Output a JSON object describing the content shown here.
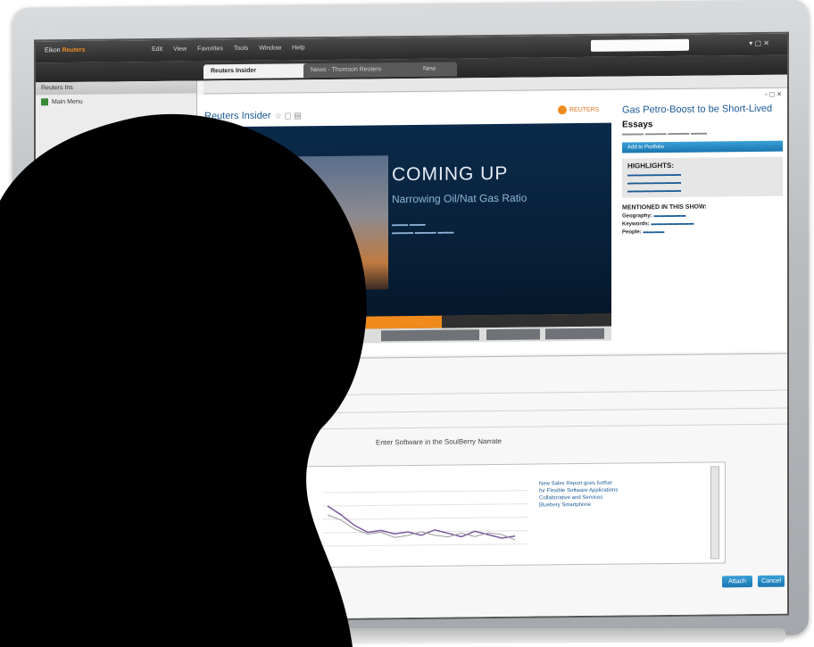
{
  "app": {
    "brand_prefix": "Eikon",
    "brand_highlight": "Reuters",
    "menu": [
      "Edit",
      "View",
      "Favorites",
      "Tools",
      "Window",
      "Help"
    ],
    "tabs": [
      {
        "label": "Reuters Insider",
        "active": true
      },
      {
        "label": "News - Thomson Reuters",
        "active": false
      },
      {
        "label": "New",
        "active": false
      }
    ]
  },
  "left_pane": {
    "header": "Reuters Ins",
    "item": "Main Menu"
  },
  "main": {
    "title": "Reuters Insider",
    "reuters_logo_text": "REUTERS",
    "video": {
      "headline": "COMING UP",
      "subhead": "Narrowing Oil/Nat Gas Ratio"
    },
    "side": {
      "story_title": "Gas Petro-Boost to be Short-Lived",
      "category": "Essays",
      "button": "Add to Portfolio",
      "highlights_title": "HIGHLIGHTS:",
      "mentioned_title": "MENTIONED IN THIS SHOW:",
      "mention_geography": "Geography:",
      "mention_keywords": "Keywords:",
      "mention_people": "People:"
    }
  },
  "lower": {
    "text": "Enter Software in the SoulBerry Narrate",
    "chart_note_lines": [
      "New Sales Report goes further",
      "for Flexible Software Applications",
      "Collaborative and Services",
      "Bluebery Smartphone"
    ]
  },
  "footer": {
    "button_left": "Attach",
    "button_right": "Cancel"
  },
  "colors": {
    "accent_orange": "#f08a1c",
    "link_blue": "#1a5a96",
    "button_blue": "#1b76b0"
  }
}
